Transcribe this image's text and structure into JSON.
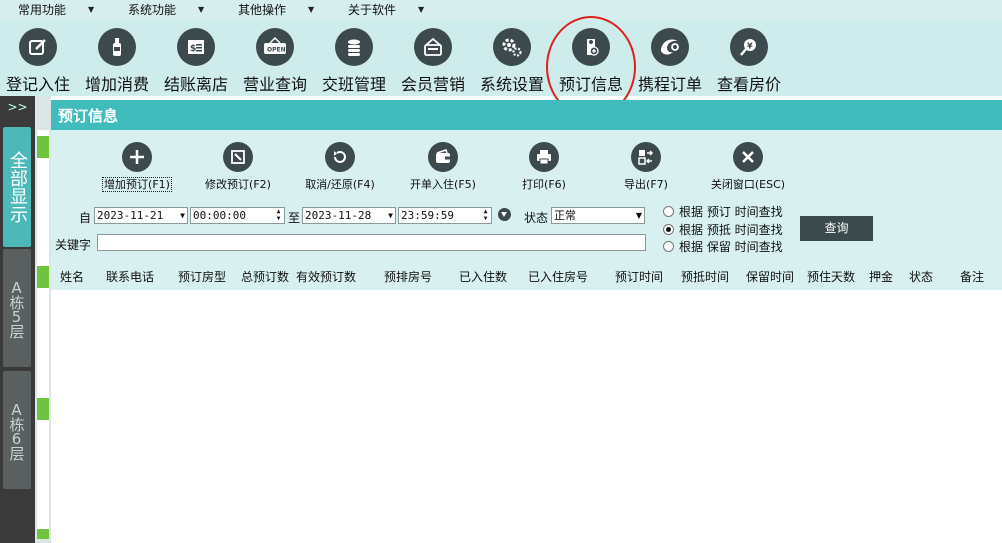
{
  "menubar": {
    "items": [
      "常用功能",
      "系统功能",
      "其他操作",
      "关于软件"
    ]
  },
  "toolbar": {
    "items": [
      {
        "label": "登记入住",
        "icon": "edit-icon"
      },
      {
        "label": "增加消费",
        "icon": "bottle-icon"
      },
      {
        "label": "结账离店",
        "icon": "bill-icon"
      },
      {
        "label": "营业查询",
        "icon": "open-sign-icon"
      },
      {
        "label": "交班管理",
        "icon": "coins-icon"
      },
      {
        "label": "会员营销",
        "icon": "member-card-icon"
      },
      {
        "label": "系统设置",
        "icon": "gear-icon"
      },
      {
        "label": "预订信息",
        "icon": "tag-plus-icon"
      },
      {
        "label": "携程订单",
        "icon": "ctrip-dolphin-icon"
      },
      {
        "label": "查看房价",
        "icon": "yen-search-icon"
      }
    ],
    "highlight_color": "#e0201c"
  },
  "left_panel": {
    "collapse_label": ">>",
    "tabs": [
      "全部显示",
      "A栋5层",
      "A栋6层"
    ]
  },
  "panel": {
    "title": "预订信息",
    "actions": [
      {
        "label": "增加预订(F1)",
        "icon": "plus-icon"
      },
      {
        "label": "修改预订(F2)",
        "icon": "edit-icon"
      },
      {
        "label": "取消/还原(F4)",
        "icon": "undo-icon"
      },
      {
        "label": "开单入住(F5)",
        "icon": "wallet-icon"
      },
      {
        "label": "打印(F6)",
        "icon": "printer-icon"
      },
      {
        "label": "导出(F7)",
        "icon": "export-icon"
      },
      {
        "label": "关闭窗口(ESC)",
        "icon": "close-icon"
      }
    ],
    "filter": {
      "from_label": "自",
      "from_date": "2023-11-21",
      "from_time": "00:00:00",
      "to_label": "至",
      "to_date": "2023-11-28",
      "to_time": "23:59:59",
      "status_label": "状态",
      "status_value": "正常",
      "keyword_label": "关键字",
      "keyword_value": "",
      "radios": [
        {
          "label": "根据 预订 时间查找",
          "checked": false
        },
        {
          "label": "根据 预抵 时间查找",
          "checked": true
        },
        {
          "label": "根据 保留 时间查找",
          "checked": false
        }
      ],
      "search_label": "查询"
    },
    "columns": [
      "姓名",
      "联系电话",
      "预订房型",
      "总预订数",
      "有效预订数",
      "预排房号",
      "已入住数",
      "已入住房号",
      "预订时间",
      "预抵时间",
      "保留时间",
      "预住天数",
      "押金",
      "状态",
      "备注"
    ],
    "rows": []
  },
  "colors": {
    "accent": "#41bcbc",
    "toolbar_bg": "#cfecec",
    "icon_dark": "#3d4a4d",
    "left_panel": "#3a3a3a"
  }
}
